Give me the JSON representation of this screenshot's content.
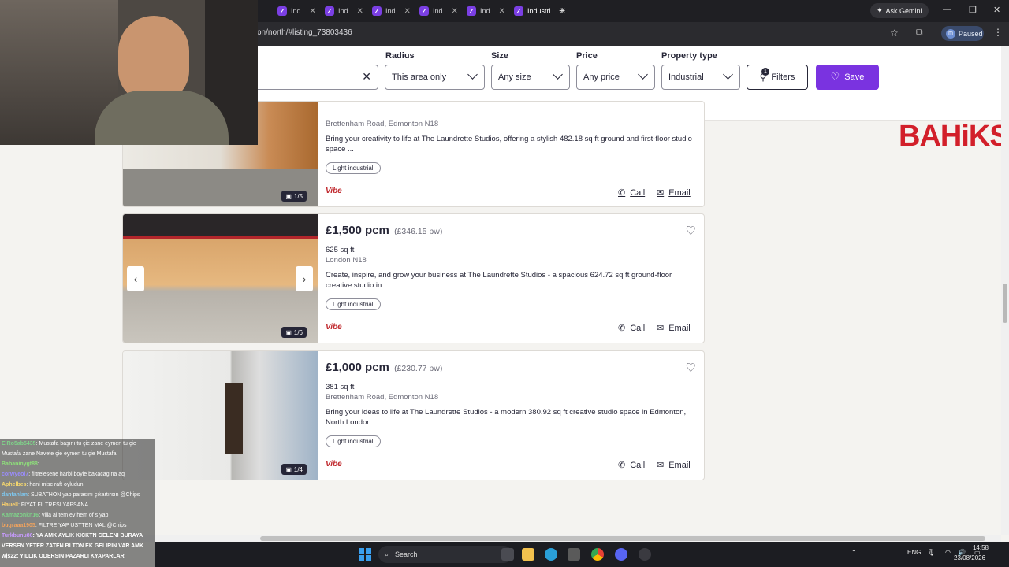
{
  "browser": {
    "tabs": [
      {
        "label": "Ind"
      },
      {
        "label": "Ind"
      },
      {
        "label": "Ind"
      },
      {
        "label": "Ind"
      },
      {
        "label": "Ind"
      },
      {
        "label": "Industri"
      }
    ],
    "new_tab": "+",
    "gemini_label": "Ask Gemini",
    "url": "on/north/#listing_73803436",
    "profile_initial": "m",
    "profile_status": "Paused"
  },
  "filters": {
    "radius_label": "Radius",
    "radius_value": "This area only",
    "size_label": "Size",
    "size_value": "Any size",
    "price_label": "Price",
    "price_value": "Any price",
    "property_type_label": "Property type",
    "property_type_value": "Industrial",
    "filters_button": "Filters",
    "filters_count": "1",
    "save_button": "Save"
  },
  "listings": [
    {
      "address": "Brettenham Road, Edmonton N18",
      "description": "Bring your creativity to life at The Laundrette Studios, offering a stylish 482.18 sq ft ground and first-floor studio space ...",
      "tag": "Light industrial",
      "photo_counter": "1/5",
      "call": "Call",
      "email": "Email",
      "agent": "Vibe"
    },
    {
      "price": "£1,500 pcm",
      "price_pw": "(£346.15 pw)",
      "size": "625 sq ft",
      "address": "London N18",
      "description": "Create, inspire, and grow your business at The Laundrette Studios - a spacious 624.72 sq ft ground-floor creative studio in ...",
      "tag": "Light industrial",
      "photo_counter": "1/6",
      "call": "Call",
      "email": "Email",
      "agent": "Vibe"
    },
    {
      "price": "£1,000 pcm",
      "price_pw": "(£230.77 pw)",
      "size": "381 sq ft",
      "address": "Brettenham Road, Edmonton N18",
      "description": "Bring your ideas to life at The Laundrette Studios - a modern 380.92 sq ft creative studio space in Edmonton, North London ...",
      "tag": "Light industrial",
      "photo_counter": "1/4",
      "call": "Call",
      "email": "Email",
      "agent": "Vibe"
    }
  ],
  "overlay_logo": "BAHiKS",
  "chat": [
    {
      "user": "ElRo5ab5435",
      "text": ": Mustafa başını tu çie zane eymen tu çie Mustafa zane Navete çie eymen tu çie Mustafa",
      "color": "#7fd38a"
    },
    {
      "user": "Babaninygt88",
      "text": ":",
      "color": "#8ee07a"
    },
    {
      "user": "corwyeol7",
      "text": ": filtrelesene harbi boyle bakacagına aq",
      "color": "#9a8cff"
    },
    {
      "user": "Aphelbes",
      "text": ": hani misc raft oyludun",
      "color": "#f5d76e"
    },
    {
      "user": "dantanlan",
      "text": ": SUBATHON yap parasını çıkartırsın @Chips",
      "color": "#7ec8f0"
    },
    {
      "user": "Hauell",
      "text": ": FIYAT FILTRESI YAPSANA",
      "color": "#ffd36b"
    },
    {
      "user": "Kamazonkn16",
      "text": ": villa al tem ev hem of s yap",
      "color": "#7fd38a"
    },
    {
      "user": "bugraaa1905",
      "text": ": FILTRE YAP USTTEN MAL @Chips",
      "color": "#f0a35e"
    },
    {
      "user": "Turkbunu86",
      "text": ": YA AMK AYLIK KICKTN GELENI BURAYA VERSEN YETER ZATEN BI TON EK GELIRIN VAR AMK",
      "color": "#c89bff"
    },
    {
      "user": "wjs22",
      "text": ": YILLIK ODERSIN PAZARLI KYAPARLAR",
      "color": "#ffffff"
    }
  ],
  "taskbar": {
    "search": "Search",
    "lang": "ENG",
    "time": "14:58",
    "date": "23/08/2026"
  }
}
